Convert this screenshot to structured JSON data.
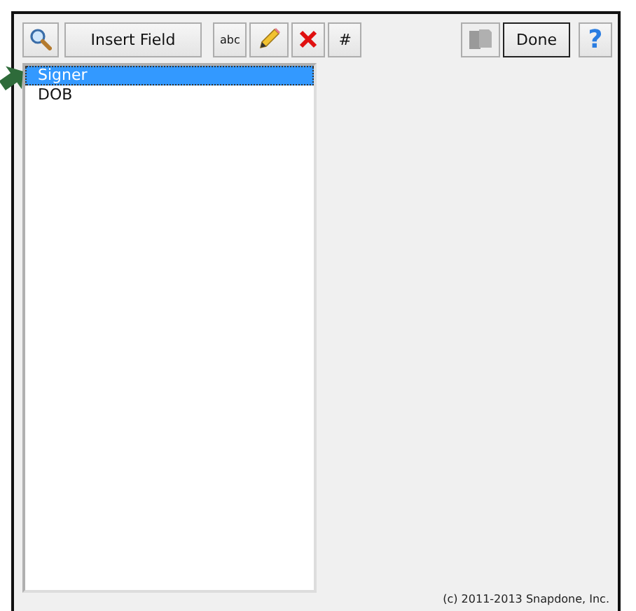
{
  "toolbar_left": [
    {
      "kind": "search"
    },
    {
      "kind": "text",
      "label": "Insert Field"
    },
    {
      "kind": "abc",
      "label": "abc"
    },
    {
      "kind": "pencil"
    },
    {
      "kind": "delete"
    },
    {
      "kind": "text",
      "label": "#"
    }
  ],
  "toolbar_right": [
    {
      "kind": "pages",
      "disabled": true
    },
    {
      "kind": "default",
      "label": "Done"
    },
    {
      "kind": "help",
      "label": "?"
    }
  ],
  "fields": [
    {
      "label": "Signer",
      "selected": true
    },
    {
      "label": "DOB",
      "selected": false
    }
  ],
  "copyright": "(c) 2011-2013 Snapdone, Inc."
}
